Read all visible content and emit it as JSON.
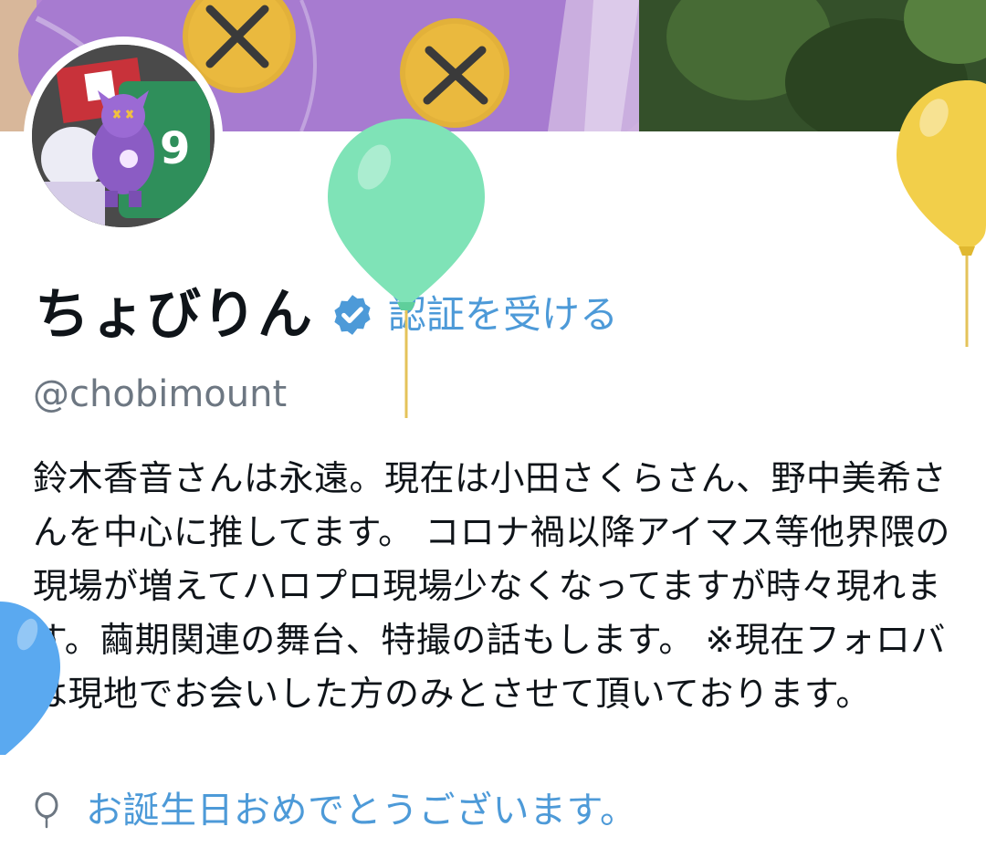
{
  "profile": {
    "display_name": "ちょびりん",
    "verified_icon": "verified-badge-icon",
    "get_verified_label": "認証を受ける",
    "handle": "@chobimount",
    "bio": "鈴木香音さんは永遠。現在は小田さくらさん、野中美希さんを中心に推してます。 コロナ禍以降アイマス等他界隈の現場が増えてハロプロ現場少なくなってますが時々現れます。繭期関連の舞台、特撮の話もします。 ※現在フォロバは現地でお会いした方のみとさせて頂いております。",
    "birthday_icon": "balloon-icon",
    "birthday_text": "お誕生日おめでとうございます。"
  },
  "colors": {
    "accent": "#4d9ad8",
    "text": "#0f1419",
    "secondary_text": "#6d7782",
    "balloon_green": "#7fe3b7",
    "balloon_yellow": "#f2cf4a",
    "balloon_blue": "#5aa9f0"
  }
}
